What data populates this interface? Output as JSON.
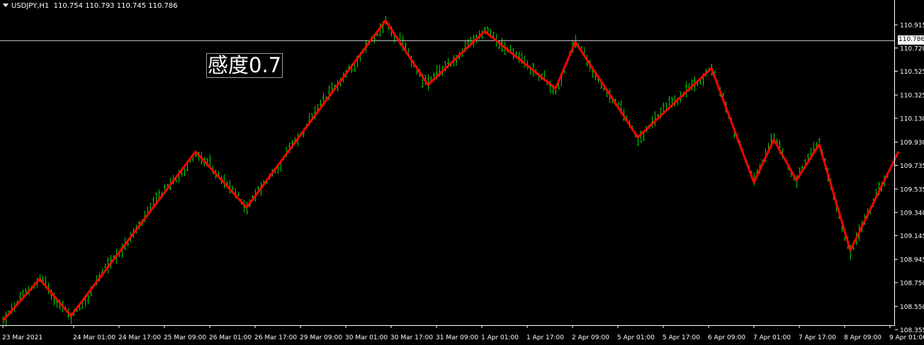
{
  "header": {
    "symbol": "USDJPY,H1",
    "ohlc": "110.754 110.793 110.745 110.786"
  },
  "annotation": {
    "label": "感度0.7"
  },
  "current_price": "110.786",
  "colors": {
    "background": "#000000",
    "bars": "#00c800",
    "zigzag": "#ff0000",
    "axis": "#ffffff",
    "price_line": "#c0c0c0"
  },
  "chart_data": {
    "type": "line",
    "title": "",
    "xlabel": "",
    "ylabel": "",
    "x_tick_labels": [
      "23 Mar 2021",
      "24 Mar 01:00",
      "24 Mar 17:00",
      "25 Mar 09:00",
      "26 Mar 01:00",
      "26 Mar 17:00",
      "29 Mar 09:00",
      "30 Mar 01:00",
      "30 Mar 17:00",
      "31 Mar 09:00",
      "1 Apr 01:00",
      "1 Apr 17:00",
      "2 Apr 09:00",
      "5 Apr 01:00",
      "5 Apr 17:00",
      "6 Apr 09:00",
      "7 Apr 01:00",
      "7 Apr 17:00",
      "8 Apr 09:00",
      "9 Apr 01:00"
    ],
    "y_tick_labels": [
      "110.915",
      "110.720",
      "110.525",
      "110.325",
      "110.130",
      "109.930",
      "109.735",
      "109.535",
      "109.340",
      "109.145",
      "108.945",
      "108.750",
      "108.550",
      "108.355"
    ],
    "ylim": [
      108.35,
      111.02
    ],
    "current_price": 110.786,
    "series": [
      {
        "name": "ZigZag",
        "points": [
          [
            "23 Mar 2021",
            108.43
          ],
          [
            "23 Mar 2021 13:00",
            108.78
          ],
          [
            "24 Mar 2021",
            108.47
          ],
          [
            "25 Mar 2021 20:00",
            109.85
          ],
          [
            "26 Mar 2021 14:00",
            109.38
          ],
          [
            "30 Mar 2021 15:00",
            110.95
          ],
          [
            "31 Mar 2021 06:00",
            110.41
          ],
          [
            "1 Apr 2021 02:00",
            110.86
          ],
          [
            "2 Apr 2021 03:00",
            110.38
          ],
          [
            "2 Apr 2021 10:00",
            110.77
          ],
          [
            "5 Apr 2021 08:00",
            109.97
          ],
          [
            "6 Apr 2021 10:00",
            110.55
          ],
          [
            "7 Apr 2021 01:00",
            109.59
          ],
          [
            "7 Apr 2021 08:00",
            109.95
          ],
          [
            "7 Apr 2021 16:00",
            109.61
          ],
          [
            "8 Apr 2021 00:00",
            109.91
          ],
          [
            "8 Apr 2021 11:00",
            109.02
          ],
          [
            "9 Apr 2021 04:00",
            109.85
          ]
        ]
      }
    ]
  }
}
